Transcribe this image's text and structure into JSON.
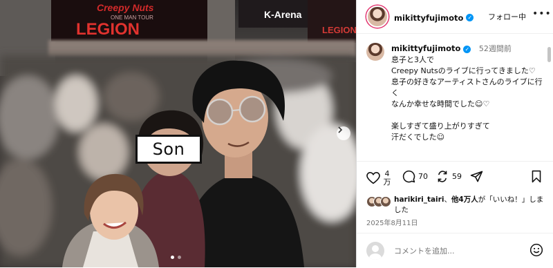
{
  "photo": {
    "sign_top": "Creepy Nuts",
    "sign_sub": "ONE MAN TOUR",
    "sign_main": "LEGION",
    "venue_sign": "K-Arena",
    "venue_sign_right": "LEGION",
    "son_label": "Son",
    "carousel_dots": 2,
    "active_dot": 0
  },
  "header": {
    "username": "mikittyfujimoto",
    "follow_label": "フォロー中",
    "more_icon": "more-horizontal-icon"
  },
  "caption": {
    "username": "mikittyfujimoto",
    "time": "52週間前",
    "text": "息子と3人で\nCreepy Nutsのライブに行ってきました♡\n息子の好きなアーティストさんのライブに行く\nなんか幸せな時間でした☺︎♡\n\n楽しすぎて盛り上がりすぎて\n汗だくでした☺︎"
  },
  "actions": {
    "likes_count": "4万",
    "comments_count": "70",
    "reposts_count": "59",
    "icons": [
      "heart-icon",
      "comment-icon",
      "repost-icon",
      "share-icon",
      "bookmark-icon"
    ]
  },
  "likes": {
    "liker": "harikiri_tairi",
    "text_mid": "、",
    "others": "他4万人",
    "text_end": "が「いいね！」しました"
  },
  "date": "2025年8月11日",
  "comment": {
    "placeholder": "コメントを追加..."
  },
  "colors": {
    "verified_blue": "#0095f6",
    "story_ring": "#e1306c",
    "muted_text": "#737373",
    "divider": "#efefef"
  }
}
